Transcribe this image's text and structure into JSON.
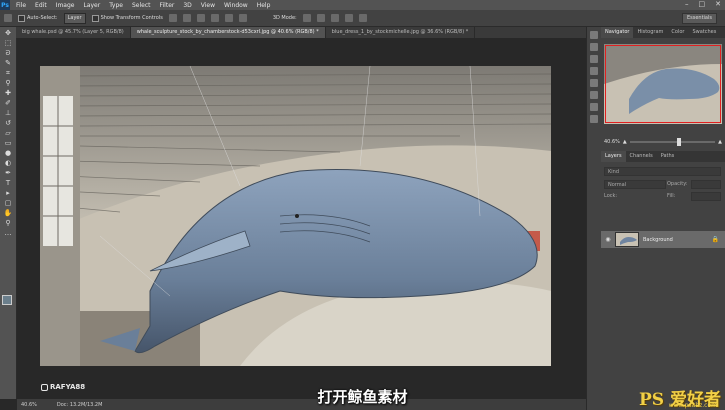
{
  "app": {
    "logo": "Ps"
  },
  "menu": [
    "File",
    "Edit",
    "Image",
    "Layer",
    "Type",
    "Select",
    "Filter",
    "3D",
    "View",
    "Window",
    "Help"
  ],
  "window_controls": [
    "minimize-icon",
    "maximize-icon",
    "close-icon"
  ],
  "options": {
    "auto_select_label": "Auto-Select:",
    "auto_select_value": "Layer",
    "show_transform_label": "Show Transform Controls",
    "mode_label": "3D Mode:",
    "workspace": "Essentials"
  },
  "tabs": [
    {
      "label": "big whale.psd @ 45.7% (Layer 5, RGB/8)",
      "active": false
    },
    {
      "label": "whale_sculpture_stock_by_chamberstock-d53cxrl.jpg @ 40.6% (RGB/8) *",
      "active": true
    },
    {
      "label": "blue_dress_1_by_stockmichelle.jpg @ 36.6% (RGB/8) *",
      "active": false
    }
  ],
  "statusbar": {
    "zoom": "40.6%",
    "doc": "Doc: 13.2M/13.2M"
  },
  "navigator": {
    "tabs": [
      "Navigator",
      "Histogram",
      "Color",
      "Swatches"
    ],
    "zoom": "40.6%"
  },
  "layers": {
    "tabs": [
      "Layers",
      "Channels",
      "Paths"
    ],
    "kind_placeholder": "Kind",
    "blend_mode": "Normal",
    "opacity_label": "Opacity:",
    "lock_label": "Lock:",
    "fill_label": "Fill:",
    "items": [
      {
        "name": "Background",
        "visible": true,
        "locked": true
      }
    ]
  },
  "watermark": {
    "instagram": "RAFYA88"
  },
  "subtitle": "打开鲸鱼素材",
  "site_logo": {
    "text": "PS 爱好者",
    "url": "www.psahz.com"
  },
  "colors": {
    "menubar": "#535353",
    "panel": "#424242",
    "active_tab": "#535353",
    "logo_yellow": "#f2d046"
  }
}
